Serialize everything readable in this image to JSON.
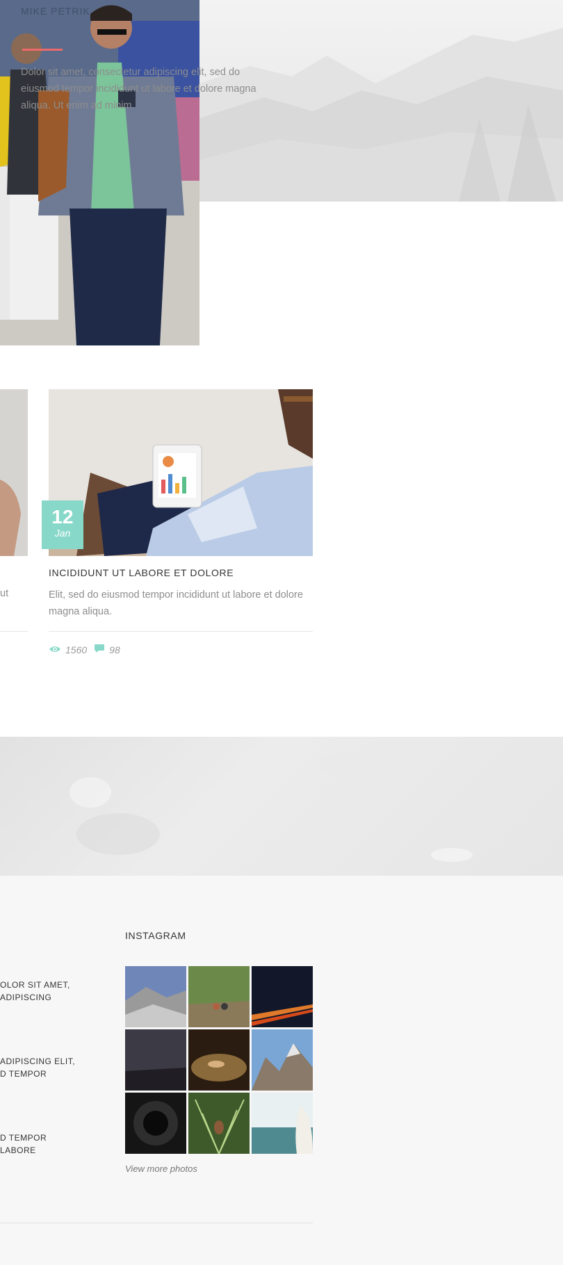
{
  "hero": {
    "name": "MIKE PETRIK",
    "text": "Dolor sit amet, consectetur adipiscing elit, sed do eiusmod tempor incididunt ut labore et dolore magna aliqua. Ut enim ad minim"
  },
  "cards": {
    "left": {
      "excerpt": "ut"
    },
    "main": {
      "day": "12",
      "month": "Jan",
      "title": "INCIDIDUNT UT LABORE ET DOLORE",
      "excerpt": "Elit, sed do eiusmod tempor incididunt ut labore et dolore magna aliqua.",
      "views": "1560",
      "comments": "98"
    }
  },
  "footer": {
    "recent": [
      {
        "line1": "OLOR SIT AMET,",
        "line2": "ADIPISCING"
      },
      {
        "line1": "ADIPISCING ELIT,",
        "line2": "D TEMPOR"
      },
      {
        "line1": "D TEMPOR",
        "line2": "LABORE"
      }
    ],
    "instagram_heading": "INSTAGRAM",
    "view_more": "View more photos"
  },
  "colors": {
    "accent": "#88d8c9",
    "underline": "#ee6a6a",
    "footer_bg": "#f7f7f7"
  },
  "icons": [
    "eye-icon",
    "comment-icon"
  ]
}
